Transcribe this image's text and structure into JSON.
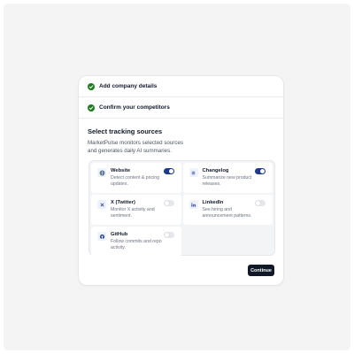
{
  "steps": [
    {
      "label": "Add company details",
      "status": "complete"
    },
    {
      "label": "Confirm your competitors",
      "status": "complete"
    }
  ],
  "section": {
    "title": "Select tracking sources",
    "description": "MarketPulse monitors selected sources and generates daily AI summaries."
  },
  "sources": [
    {
      "name": "Website",
      "description": "Detect content & pricing updates.",
      "enabled": true,
      "icon": "globe-icon"
    },
    {
      "name": "Changelog",
      "description": "Summarize new product releases.",
      "enabled": true,
      "icon": "list-icon"
    },
    {
      "name": "X (Twitter)",
      "description": "Monitor X activity and sentiment.",
      "enabled": false,
      "icon": "x-icon"
    },
    {
      "name": "LinkedIn",
      "description": "See hiring and announcement patterns.",
      "enabled": false,
      "icon": "linkedin-icon"
    },
    {
      "name": "GitHub",
      "description": "Follow commits and repo activity.",
      "enabled": false,
      "icon": "github-icon"
    }
  ],
  "actions": {
    "continue_label": "Continue"
  },
  "colors": {
    "accent": "#1e3a8a",
    "check": "#1f7a1f",
    "button": "#111827"
  }
}
